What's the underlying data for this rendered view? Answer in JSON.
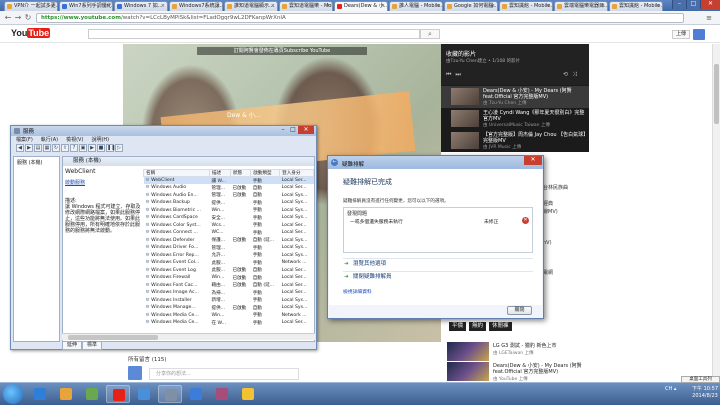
{
  "browser": {
    "tabs": [
      {
        "label": "VPN介 一起試多更…",
        "color": "#e8a33a"
      },
      {
        "label": "Win7系列手調優化…",
        "color": "#3a6fd8"
      },
      {
        "label": "Windows 7 如…",
        "color": "#3a6fd8"
      },
      {
        "label": "Windows7系統讓…",
        "color": "#e8a33a"
      },
      {
        "label": "誰知道電腦顯示…",
        "color": "#e8a33a"
      },
      {
        "label": "雲知道電腦樂 - Mobi…",
        "color": "#e8a33a"
      },
      {
        "label": "Dears(Dew & 小…",
        "color": "#e62117"
      },
      {
        "label": "誰人電腦 - Mobile…",
        "color": "#e8a33a"
      },
      {
        "label": "Google 如何電腦…",
        "color": "#e8a33a"
      },
      {
        "label": "雲知識館 - Mobile…",
        "color": "#e8a33a"
      },
      {
        "label": "雲端電腦樂電器目…",
        "color": "#e8a33a"
      },
      {
        "label": "雲知識館 - Mobile…",
        "color": "#e8a33a"
      }
    ],
    "url_host": "https://www.youtube.com",
    "url_path": "/watch?v=LCcLByMPiSk&list=FLadOgqr9wL2DFKanpWrXnIA",
    "back_icon": "arrow-left",
    "forward_icon": "arrow-right",
    "reload_icon": "reload",
    "menu_icon": "hamburger"
  },
  "youtube": {
    "logo_you": "You",
    "logo_tube": "Tube",
    "upload_label": "上傳",
    "video_overlay": "訂閱阿賢會發佈在專頁Subscribe YouTube",
    "video_caption": "Dew & 小…",
    "playlist": {
      "title": "收藏的影片",
      "subtitle": "由Tzu-Yu Chen建立 • 1/108 的影片",
      "items": [
        {
          "title": "Dears(Dew & 小安) - My Dears (阿賢feat.Official 官方完整版MV)",
          "sub": "由 Tzu-Yu Chen 上傳"
        },
        {
          "title": "王心凌 Cyndi Wang《那年夏天很別白》完整官方MV",
          "sub": "由 UniversalMusic Taiwan 上傳"
        },
        {
          "title": "【官方完整版】周杰倫 Jay Chou 【告白氣球】完整版MV",
          "sub": "由 JVR Music 上傳"
        }
      ]
    },
    "right_frags": [
      "台林民族曲",
      "經典",
      "線MV)",
      "nV)",
      "電網"
    ],
    "related_tabs": [
      "平價",
      "無約",
      "休閒褲"
    ],
    "related": [
      {
        "title": "LG G3 測試 - 獵豹 新色上市",
        "sub": "由 LGETaiwan 上傳"
      },
      {
        "title": "Dears(Dew & 小安) - My Dears (阿賢feat.Official 官方完整版MV)",
        "sub": "由 YouTube 上傳"
      }
    ],
    "comments_head": "所有留言 (115)",
    "comment_placeholder": "分享你的想法..."
  },
  "services": {
    "title": "服務",
    "menu": [
      "檔案(F)",
      "執行(A)",
      "檢視(V)",
      "說明(H)"
    ],
    "tree_item": "服務 (本機)",
    "main_head": "服務 (本機)",
    "detail_name": "WebClient",
    "detail_link": "啟動服務",
    "detail_desc_label": "描述:",
    "detail_desc": "讓 Windows 程式可建立、存取及修改網際網路檔案，如果此服務停止，這些功能將無法使用。如果此服務停用，所有明確地依存於此服務的服務將無法啟動。",
    "columns": [
      "名稱",
      "描述",
      "狀態",
      "啟動類型",
      "登入身分"
    ],
    "rows": [
      [
        "WebClient",
        "讓 W...",
        "",
        "手動",
        "Local Ser..."
      ],
      [
        "Windows Audio",
        "管理...",
        "已啟動",
        "自動",
        "Local Ser..."
      ],
      [
        "Windows Audio En...",
        "管理...",
        "已啟動",
        "自動",
        "Local Sys..."
      ],
      [
        "Windows Backup",
        "提供...",
        "",
        "手動",
        "Local Sys..."
      ],
      [
        "Windows Biometric ...",
        "Win...",
        "",
        "手動",
        "Local Sys..."
      ],
      [
        "Windows CardSpace",
        "安全...",
        "",
        "手動",
        "Local Sys..."
      ],
      [
        "Windows Color Syst...",
        "Wcs...",
        "",
        "手動",
        "Local Ser..."
      ],
      [
        "Windows Connect ...",
        "WC...",
        "",
        "手動",
        "Local Ser..."
      ],
      [
        "Windows Defender",
        "保護...",
        "已啟動",
        "自動 (延...",
        "Local Sys..."
      ],
      [
        "Windows Driver Fo...",
        "管理...",
        "",
        "手動",
        "Local Sys..."
      ],
      [
        "Windows Error Rep...",
        "允許...",
        "",
        "手動",
        "Local Sys..."
      ],
      [
        "Windows Event Col...",
        "此服...",
        "",
        "手動",
        "Network ..."
      ],
      [
        "Windows Event Log",
        "此服...",
        "已啟動",
        "自動",
        "Local Ser..."
      ],
      [
        "Windows Firewall",
        "Win...",
        "已啟動",
        "自動",
        "Local Ser..."
      ],
      [
        "Windows Font Cac...",
        "藉由...",
        "已啟動",
        "自動 (延...",
        "Local Ser..."
      ],
      [
        "Windows Image Ac...",
        "為掃...",
        "",
        "手動",
        "Local Ser..."
      ],
      [
        "Windows Installer",
        "新增...",
        "",
        "手動",
        "Local Sys..."
      ],
      [
        "Windows Manage...",
        "提供...",
        "已啟動",
        "自動",
        "Local Sys..."
      ],
      [
        "Windows Media Ce...",
        "Win...",
        "",
        "手動",
        "Network ..."
      ],
      [
        "Windows Media Ce...",
        "在 W...",
        "",
        "手動",
        "Local Ser..."
      ]
    ],
    "tabs": [
      "延伸",
      "標準"
    ]
  },
  "troubleshooter": {
    "title": "疑難排解",
    "heading": "疑難排解已完成",
    "desc": "疑難排解員沒有進行任何變更，您可以以下的選項。",
    "grid_head": "發現問題",
    "problem": "一或多個遺失服務未執行",
    "status": "未修正",
    "options": [
      "瀏覽其他選項",
      "關閉疑難排解員"
    ],
    "more": "檢視詳細資料",
    "close_label": "關閉"
  },
  "taskbar": {
    "apps": [
      {
        "color": "#2f7fd8"
      },
      {
        "color": "#e8a33a"
      },
      {
        "color": "#6aa84f"
      },
      {
        "color": "#e62117"
      },
      {
        "color": "#4a90d9"
      },
      {
        "color": "#7f8fa6"
      },
      {
        "color": "#3b7dd8"
      },
      {
        "color": "#a64d79"
      },
      {
        "color": "#f1c232"
      }
    ],
    "time": "下午 10:57",
    "date": "2014/8/23",
    "lang": "CH",
    "desktop_tip": "桌面工具列"
  }
}
